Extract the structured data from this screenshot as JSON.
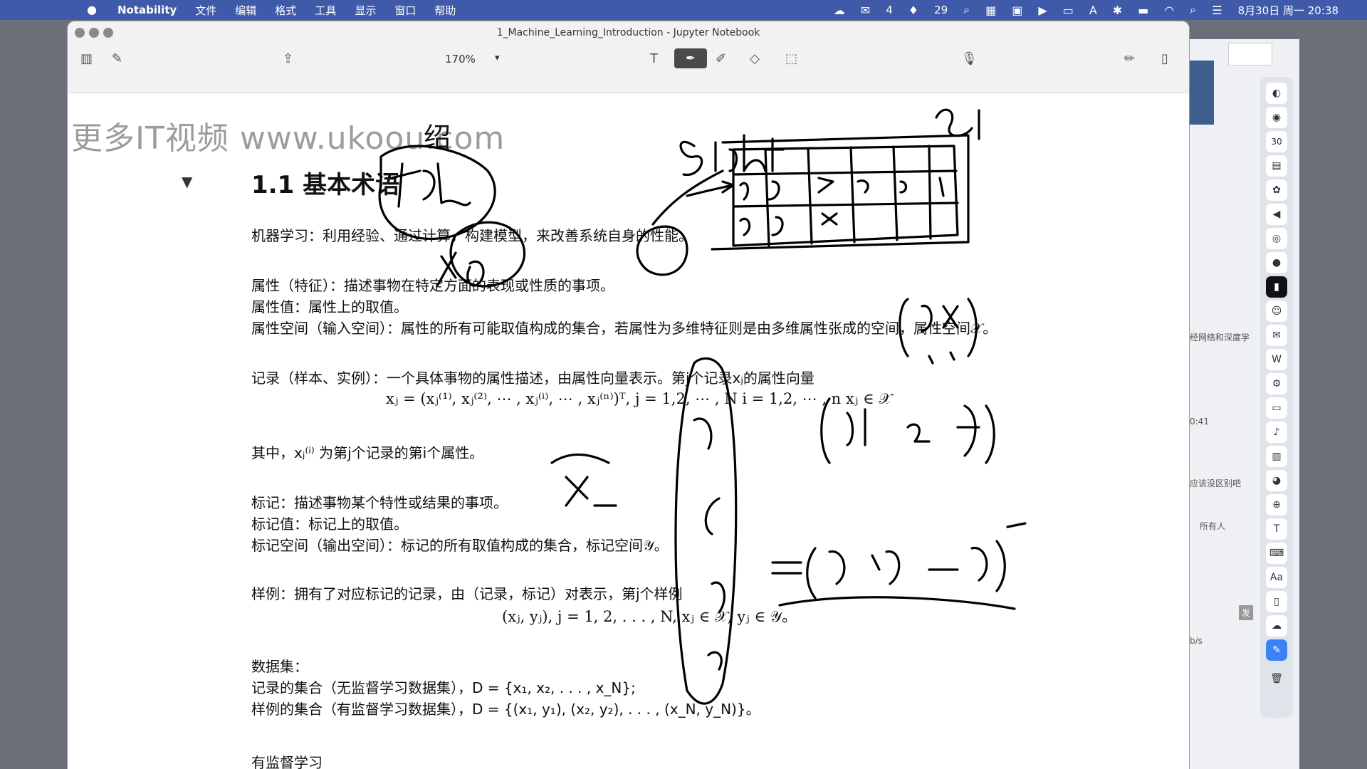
{
  "menubar": {
    "app": "Notability",
    "items": [
      "文件",
      "编辑",
      "格式",
      "工具",
      "显示",
      "窗口",
      "帮助"
    ],
    "status_count_a": "4",
    "status_count_b": "29",
    "datetime": "8月30日 周一 20:38"
  },
  "window": {
    "title": "1_Machine_Learning_Introduction - Jupyter Notebook",
    "zoom": "170%"
  },
  "background_app": {
    "snippets": [
      "经网络和深度学",
      "0:41",
      "应该没区别吧",
      "所有人",
      "发",
      "b/s"
    ],
    "dock_badge": "30"
  },
  "notebook": {
    "watermark": "更多IT视频 www.ukoou.com",
    "watermark_tail": "绍",
    "heading": "1.1 基本术语",
    "ml_def": "机器学习：利用经验、通过计算，构建模型，来改善系统自身的性能。",
    "attr": "属性（特征）：描述事物在特定方面的表现或性质的事项。",
    "attr_value": "属性值：属性上的取值。",
    "attr_space": "属性空间（输入空间）：属性的所有可能取值构成的集合，若属性为多维特征则是由多维属性张成的空间，属性空间𝒳。",
    "record": "记录（样本、实例）：一个具体事物的属性描述，由属性向量表示。第j个记录xⱼ的属性向量",
    "record_formula": "xⱼ = (xⱼ⁽¹⁾, xⱼ⁽²⁾, ⋯ , xⱼ⁽ⁱ⁾, ⋯ , xⱼ⁽ⁿ⁾)ᵀ,    j = 1,2, ⋯ , N    i = 1,2, ⋯ , n    xⱼ ∈ 𝒳",
    "record_note": "其中，xⱼ⁽ⁱ⁾ 为第j个记录的第i个属性。",
    "label": "标记：描述事物某个特性或结果的事项。",
    "label_value": "标记值：标记上的取值。",
    "label_space": "标记空间（输出空间）：标记的所有取值构成的集合，标记空间𝒴。",
    "example": "样例：拥有了对应标记的记录，由（记录，标记）对表示，第j个样例",
    "example_formula": "(xⱼ, yⱼ),    j = 1, 2, . . . , N,    xⱼ ∈ 𝒳, yⱼ ∈ 𝒴。",
    "dataset": "数据集：",
    "unsup": "记录的集合（无监督学习数据集），D = {x₁, x₂, . . . , x_N};",
    "sup": "样例的集合（有监督学习数据集），D = {(x₁, y₁), (x₂, y₂), . . . , (x_N, y_N)}。",
    "next": "有监督学习"
  }
}
